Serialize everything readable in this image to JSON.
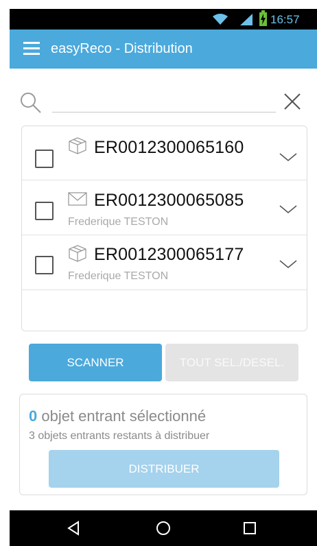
{
  "status_bar": {
    "time": "16:57",
    "icons": [
      "wifi-icon",
      "signal-icon",
      "battery-charging-icon"
    ]
  },
  "app_bar": {
    "title": "easyReco - Distribution",
    "menu_icon": "menu-icon"
  },
  "search": {
    "value": "",
    "placeholder": "",
    "search_icon": "search-icon",
    "clear_icon": "close-icon"
  },
  "items": [
    {
      "tracking": "ER0012300065160",
      "recipient": "",
      "type_icon": "package-icon",
      "checked": false
    },
    {
      "tracking": "ER0012300065085",
      "recipient": "Frederique TESTON",
      "type_icon": "envelope-icon",
      "checked": false
    },
    {
      "tracking": "ER0012300065177",
      "recipient": "Frederique TESTON",
      "type_icon": "package-icon",
      "checked": false
    }
  ],
  "actions": {
    "scanner_label": "SCANNER",
    "toggle_all_label": "TOUT SEL./DESEL."
  },
  "summary": {
    "selected_count": "0",
    "selected_text": " objet entrant sélectionné",
    "remaining_text": "3 objets entrants restants à distribuer",
    "distribute_label": "DISTRIBUER"
  },
  "colors": {
    "accent": "#4ba9dc",
    "disabled_button": "#e4e4e4",
    "distribute_disabled": "#a5d2ec",
    "muted_text": "#8a8a8a"
  },
  "nav_bar": {
    "buttons": [
      "back-icon",
      "home-icon",
      "recent-apps-icon"
    ]
  }
}
